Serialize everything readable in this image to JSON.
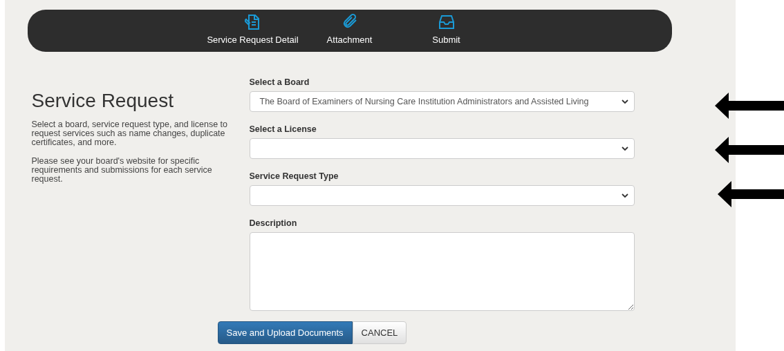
{
  "steps": [
    {
      "label": "Service Request Detail",
      "kind": "document"
    },
    {
      "label": "Attachment",
      "kind": "paperclip"
    },
    {
      "label": "Submit",
      "kind": "inbox"
    }
  ],
  "intro": {
    "title": "Service Request",
    "paragraphs": [
      "Select a board, service request type, and license to request services such as name changes, duplicate certificates, and more.",
      "Please see your board's website for specific requirements and submissions for each service request."
    ]
  },
  "fields": [
    {
      "label": "Select a Board",
      "kind": "select",
      "value": "The Board of Examiners of Nursing Care Institution Administrators and Assisted Living"
    },
    {
      "label": "Select a License",
      "kind": "select"
    },
    {
      "label": "Service Request Type",
      "kind": "select"
    },
    {
      "label": "Description",
      "kind": "textarea"
    }
  ],
  "buttons": [
    {
      "label": "Save and Upload Documents",
      "kind": "primary"
    },
    {
      "label": "CANCEL",
      "kind": "default"
    }
  ],
  "annotation_arrows": [
    {
      "kind": "arrow"
    },
    {
      "kind": "arrow"
    },
    {
      "kind": "arrow"
    }
  ]
}
